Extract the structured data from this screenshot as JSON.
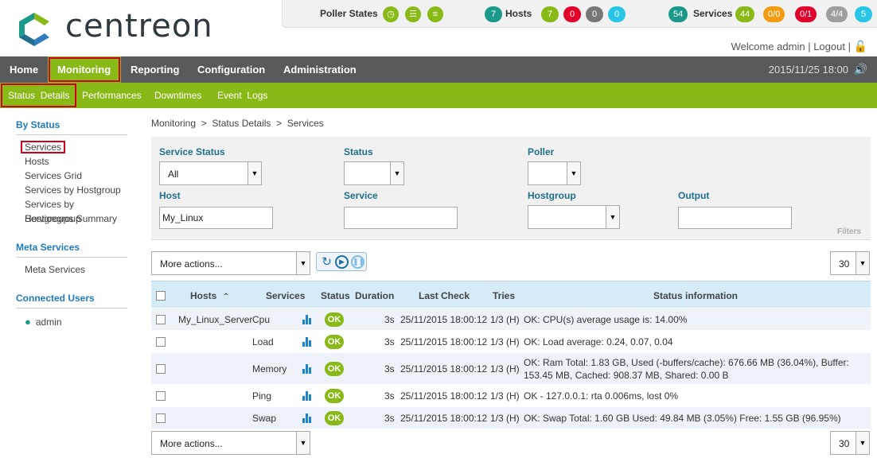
{
  "brand": {
    "name": "centreon"
  },
  "topbar": {
    "poller_label": "Poller States",
    "hosts": {
      "count": "7",
      "label": "Hosts",
      "up": "7",
      "down": "0",
      "unreachable": "0",
      "pending": "0"
    },
    "services": {
      "count": "54",
      "label": "Services",
      "ok": "44",
      "warning": "0/0",
      "critical": "0/1",
      "unknown": "4/4",
      "pending": "5"
    },
    "welcome": "Welcome admin",
    "logout": "Logout"
  },
  "nav": {
    "items": [
      "Home",
      "Monitoring",
      "Reporting",
      "Configuration",
      "Administration"
    ],
    "datetime": "2015/11/25 18:00"
  },
  "subnav": {
    "items": [
      "Status  Details",
      "Performances",
      "Downtimes",
      "Event  Logs"
    ]
  },
  "sidebar": {
    "by_status_title": "By Status",
    "by_status": [
      "Services",
      "Hosts",
      "Services Grid",
      "Services by Hostgroup",
      "Services by Servicegroup",
      "Hostgroups Summary"
    ],
    "meta_title": "Meta Services",
    "meta_items": [
      "Meta Services"
    ],
    "users_title": "Connected Users",
    "users": [
      "admin"
    ]
  },
  "breadcrumb": "Monitoring  >  Status Details  >  Services",
  "filters": {
    "service_status_label": "Service Status",
    "service_status_value": "All",
    "status_label": "Status",
    "poller_label": "Poller",
    "host_label": "Host",
    "host_value": "My_Linux",
    "service_label": "Service",
    "hostgroup_label": "Hostgroup",
    "output_label": "Output",
    "panel_label": "Filters"
  },
  "actions": {
    "more_actions": "More actions...",
    "per_page": "30"
  },
  "table": {
    "headers": [
      "Hosts",
      "Services",
      "Status",
      "Duration",
      "Last Check",
      "Tries",
      "Status information"
    ],
    "rows": [
      {
        "host": "My_Linux_Server",
        "service": "Cpu",
        "status": "OK",
        "duration": "3s",
        "last_check": "25/11/2015 18:00:12",
        "tries": "1/3 (H)",
        "info": "OK: CPU(s) average usage is: 14.00%"
      },
      {
        "host": "",
        "service": "Load",
        "status": "OK",
        "duration": "3s",
        "last_check": "25/11/2015 18:00:12",
        "tries": "1/3 (H)",
        "info": "OK: Load average: 0.24, 0.07, 0.04"
      },
      {
        "host": "",
        "service": "Memory",
        "status": "OK",
        "duration": "3s",
        "last_check": "25/11/2015 18:00:12",
        "tries": "1/3 (H)",
        "info": "OK: Ram Total: 1.83 GB, Used (-buffers/cache): 676.66 MB (36.04%), Buffer: 153.45 MB, Cached: 908.37 MB, Shared: 0.00 B"
      },
      {
        "host": "",
        "service": "Ping",
        "status": "OK",
        "duration": "3s",
        "last_check": "25/11/2015 18:00:12",
        "tries": "1/3 (H)",
        "info": "OK - 127.0.0.1: rta 0.006ms, lost 0%"
      },
      {
        "host": "",
        "service": "Swap",
        "status": "OK",
        "duration": "3s",
        "last_check": "25/11/2015 18:00:12",
        "tries": "1/3 (H)",
        "info": "OK: Swap Total: 1.60 GB Used: 49.84 MB (3.05%) Free: 1.55 GB (96.95%)"
      }
    ]
  },
  "colors": {
    "green": "#88b917",
    "dark_nav": "#58595b",
    "teal": "#1b9a8c",
    "red": "#e0002a",
    "orange": "#f39c12",
    "grey": "#9e9e9e",
    "cyan": "#29c5e6",
    "highlight": "#d0021b"
  }
}
